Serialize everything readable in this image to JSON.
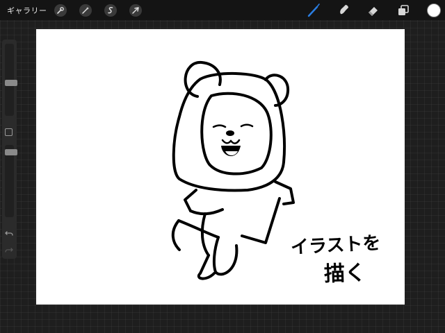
{
  "toolbar": {
    "gallery_label": "ギャラリー",
    "actions": [
      {
        "name": "actions-icon"
      },
      {
        "name": "adjustments-icon"
      },
      {
        "name": "selection-icon"
      },
      {
        "name": "transform-icon"
      }
    ],
    "tools": [
      {
        "name": "brush-icon",
        "active": true
      },
      {
        "name": "smudge-icon",
        "active": false
      },
      {
        "name": "eraser-icon",
        "active": false
      },
      {
        "name": "layers-icon",
        "active": false
      }
    ],
    "current_color": "#ffffff",
    "accent_color": "#2a7de1"
  },
  "sidebar": {
    "brush_size_level": 0.45,
    "opacity_level": 0.8,
    "undo_icon": "undo-icon",
    "redo_icon": "redo-icon"
  },
  "canvas": {
    "caption_line1": "イラストを",
    "caption_line2": "描く"
  }
}
